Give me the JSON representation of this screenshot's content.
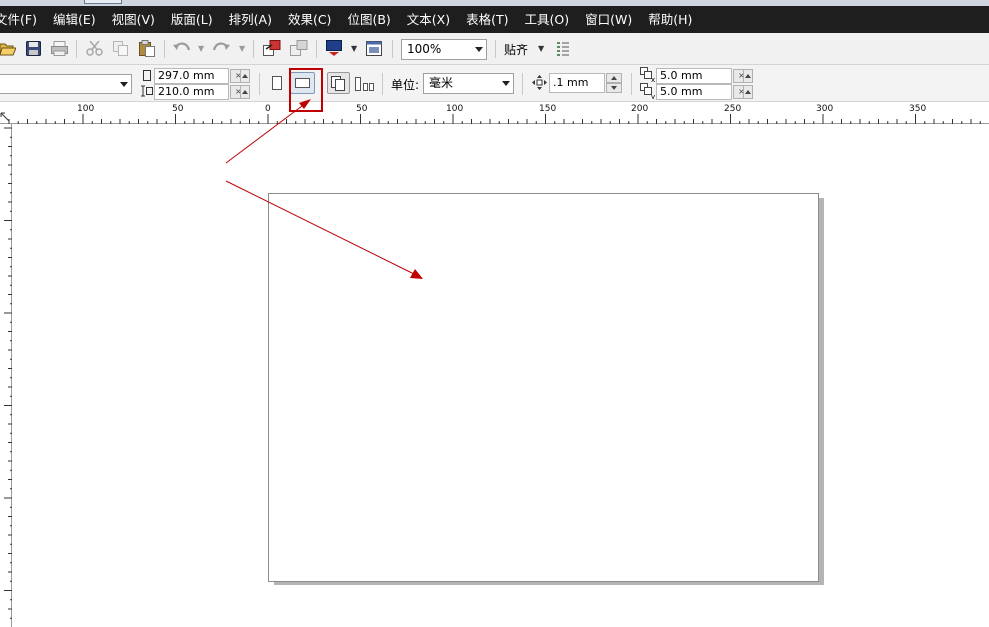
{
  "menu": {
    "items": [
      {
        "label": "文件(F)"
      },
      {
        "label": "编辑(E)"
      },
      {
        "label": "视图(V)"
      },
      {
        "label": "版面(L)"
      },
      {
        "label": "排列(A)"
      },
      {
        "label": "效果(C)"
      },
      {
        "label": "位图(B)"
      },
      {
        "label": "文本(X)"
      },
      {
        "label": "表格(T)"
      },
      {
        "label": "工具(O)"
      },
      {
        "label": "窗口(W)"
      },
      {
        "label": "帮助(H)"
      }
    ]
  },
  "toolbar": {
    "zoom_value": "100%",
    "snap_label": "贴齐"
  },
  "property_bar": {
    "page_width": "297.0 mm",
    "page_height": "210.0 mm",
    "unit_label": "单位:",
    "unit_value": "毫米",
    "nudge_value": ".1 mm",
    "duplicate_x": "5.0 mm",
    "duplicate_y": "5.0 mm"
  },
  "ruler": {
    "h_labels": [
      "100",
      "50",
      "0",
      "50",
      "100",
      "150",
      "200",
      "250",
      "300",
      "350"
    ]
  },
  "colors": {
    "menu_bg": "#1e1e1e",
    "toolbar_bg": "#f1f1f1",
    "annotation_red": "#c00000",
    "page_shadow": "#b4b4b4"
  }
}
